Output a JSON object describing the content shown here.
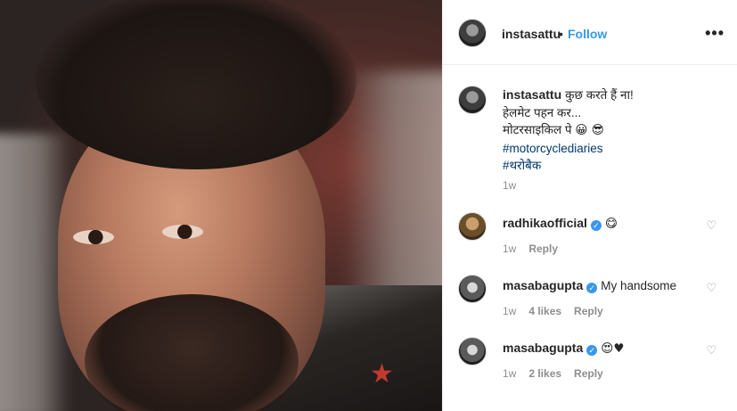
{
  "post": {
    "username": "instasattu",
    "follow_label": "Follow",
    "dot": "•",
    "more_label": "•••"
  },
  "caption": {
    "username": "instasattu",
    "line1": "कुछ करते हैं ना!",
    "line2": "हेलमेट पहन कर...",
    "line3": "मोटरसाइकिल पे",
    "line3_emoji": "😀 😎",
    "hashtag1": "#motorcyclediaries",
    "hashtag2": "#थरोबैक",
    "time": "1w"
  },
  "comments": [
    {
      "username": "radhikaofficial",
      "text": "😋",
      "time": "1w",
      "likes": "",
      "reply": "Reply"
    },
    {
      "username": "masabagupta",
      "text": "My handsome",
      "time": "1w",
      "likes": "4 likes",
      "reply": "Reply"
    },
    {
      "username": "masabagupta",
      "text": "😍♥",
      "time": "1w",
      "likes": "2 likes",
      "reply": "Reply"
    }
  ],
  "icons": {
    "verified": "✓",
    "heart": "♡"
  }
}
